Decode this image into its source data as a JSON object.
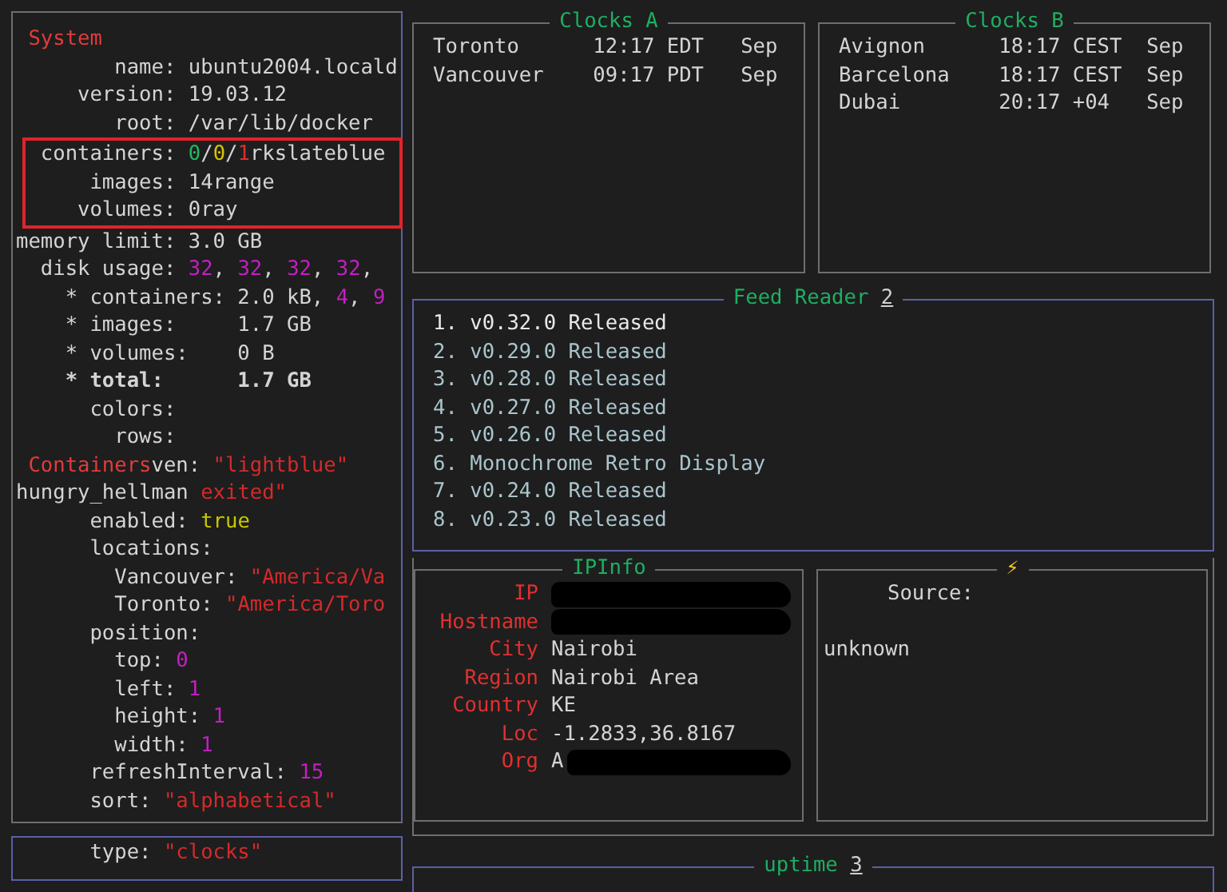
{
  "system_panel": {
    "lines": [
      {
        "segments": [
          {
            "text": " System",
            "color": "#e23b3b"
          }
        ]
      },
      {
        "segments": [
          {
            "text": "        name: ubuntu2004.locald"
          }
        ]
      },
      {
        "segments": [
          {
            "text": "     version: 19.03.12"
          }
        ]
      },
      {
        "segments": [
          {
            "text": "        root: /var/lib/docker"
          }
        ]
      },
      {
        "highlighted": true,
        "segments": [
          {
            "text": "  containers: "
          },
          {
            "text": "0",
            "color": "#1fb860"
          },
          {
            "text": "/"
          },
          {
            "text": "0",
            "color": "#d8c400"
          },
          {
            "text": "/"
          },
          {
            "text": "1",
            "color": "#d83030"
          },
          {
            "text": "rkslateblue"
          }
        ]
      },
      {
        "highlighted": true,
        "segments": [
          {
            "text": "      images: 14range"
          }
        ]
      },
      {
        "highlighted": true,
        "segments": [
          {
            "text": "     volumes: 0ray"
          }
        ]
      },
      {
        "segments": [
          {
            "text": "memory limit: 3.0 GB"
          }
        ]
      },
      {
        "segments": [
          {
            "text": "  disk usage: "
          },
          {
            "text": "32",
            "color": "#c21fc2"
          },
          {
            "text": ", "
          },
          {
            "text": "32",
            "color": "#c21fc2"
          },
          {
            "text": ", "
          },
          {
            "text": "32",
            "color": "#c21fc2"
          },
          {
            "text": ", "
          },
          {
            "text": "32",
            "color": "#c21fc2"
          },
          {
            "text": ","
          }
        ]
      },
      {
        "segments": [
          {
            "text": "    * containers: 2.0 kB, "
          },
          {
            "text": "4",
            "color": "#c21fc2"
          },
          {
            "text": ", "
          },
          {
            "text": "9",
            "color": "#c21fc2"
          }
        ]
      },
      {
        "segments": [
          {
            "text": "    * images:     1.7 GB"
          }
        ]
      },
      {
        "segments": [
          {
            "text": "    * volumes:    0 B"
          }
        ]
      },
      {
        "bold": true,
        "segments": [
          {
            "text": "    * total:      1.7 GB"
          }
        ]
      },
      {
        "segments": [
          {
            "text": "      colors:"
          }
        ]
      },
      {
        "segments": [
          {
            "text": "        rows:"
          }
        ]
      },
      {
        "segments": [
          {
            "text": " Containers",
            "color": "#e23b3b"
          },
          {
            "text": "ven: "
          },
          {
            "text": "\"lightblue\"",
            "color": "#d42a2a"
          }
        ]
      },
      {
        "segments": [
          {
            "text": "hungry_hellman "
          },
          {
            "text": "exited\"",
            "color": "#d42a2a"
          }
        ]
      },
      {
        "segments": [
          {
            "text": "      enabled: "
          },
          {
            "text": "true",
            "color": "#c8c800"
          }
        ]
      },
      {
        "segments": [
          {
            "text": "      locations:"
          }
        ]
      },
      {
        "segments": [
          {
            "text": "        Vancouver: "
          },
          {
            "text": "\"America/Va",
            "color": "#d42a2a"
          }
        ]
      },
      {
        "segments": [
          {
            "text": "        Toronto: "
          },
          {
            "text": "\"America/Toro",
            "color": "#d42a2a"
          }
        ]
      },
      {
        "segments": [
          {
            "text": "      position:"
          }
        ]
      },
      {
        "segments": [
          {
            "text": "        top: "
          },
          {
            "text": "0",
            "color": "#c21fc2"
          }
        ]
      },
      {
        "segments": [
          {
            "text": "        left: "
          },
          {
            "text": "1",
            "color": "#c21fc2"
          }
        ]
      },
      {
        "segments": [
          {
            "text": "        height: "
          },
          {
            "text": "1",
            "color": "#c21fc2"
          }
        ]
      },
      {
        "segments": [
          {
            "text": "        width: "
          },
          {
            "text": "1",
            "color": "#c21fc2"
          }
        ]
      },
      {
        "segments": [
          {
            "text": "      refreshInterval: "
          },
          {
            "text": "15",
            "color": "#c21fc2"
          }
        ]
      },
      {
        "segments": [
          {
            "text": "      sort: "
          },
          {
            "text": "\"alphabetical\"",
            "color": "#d42a2a"
          }
        ]
      }
    ]
  },
  "type_panel": {
    "lines": [
      {
        "segments": [
          {
            "text": "      type: "
          },
          {
            "text": "\"clocks\"",
            "color": "#d42a2a"
          }
        ]
      }
    ]
  },
  "clocks_a": {
    "title": "Clocks A",
    "rows": [
      {
        "city": "Toronto",
        "time": "12:17",
        "zone": "EDT",
        "date": "Sep"
      },
      {
        "city": "Vancouver",
        "time": "09:17",
        "zone": "PDT",
        "date": "Sep"
      }
    ]
  },
  "clocks_b": {
    "title": "Clocks B",
    "rows": [
      {
        "city": "Avignon",
        "time": "18:17",
        "zone": "CEST",
        "date": "Sep"
      },
      {
        "city": "Barcelona",
        "time": "18:17",
        "zone": "CEST",
        "date": "Sep"
      },
      {
        "city": "Dubai",
        "time": "20:17",
        "zone": "+04",
        "date": "Sep"
      }
    ]
  },
  "feed_reader": {
    "title": "Feed Reader",
    "hotkey": "2",
    "items": [
      {
        "number": "1.",
        "title": "v0.32.0 Released",
        "selected": true
      },
      {
        "number": "2.",
        "title": "v0.29.0 Released",
        "selected": false
      },
      {
        "number": "3.",
        "title": "v0.28.0 Released",
        "selected": false
      },
      {
        "number": "4.",
        "title": "v0.27.0 Released",
        "selected": false
      },
      {
        "number": "5.",
        "title": "v0.26.0 Released",
        "selected": false
      },
      {
        "number": "6.",
        "title": "Monochrome Retro Display",
        "selected": false
      },
      {
        "number": "7.",
        "title": "v0.24.0 Released",
        "selected": false
      },
      {
        "number": "8.",
        "title": "v0.23.0 Released",
        "selected": false
      }
    ]
  },
  "ipinfo": {
    "title": "IPInfo",
    "rows": [
      {
        "label": "IP",
        "redacted": true
      },
      {
        "label": "Hostname",
        "redacted": true
      },
      {
        "label": "City",
        "value": "Nairobi"
      },
      {
        "label": "Region",
        "value": "Nairobi Area"
      },
      {
        "label": "Country",
        "value": "KE"
      },
      {
        "label": "Loc",
        "value": "-1.2833,36.8167"
      },
      {
        "label": "Org",
        "value": "A",
        "redacted": true
      }
    ]
  },
  "power": {
    "title": "⚡",
    "label": "Source:",
    "value": "unknown"
  },
  "uptime": {
    "title": "uptime",
    "hotkey": "3"
  }
}
